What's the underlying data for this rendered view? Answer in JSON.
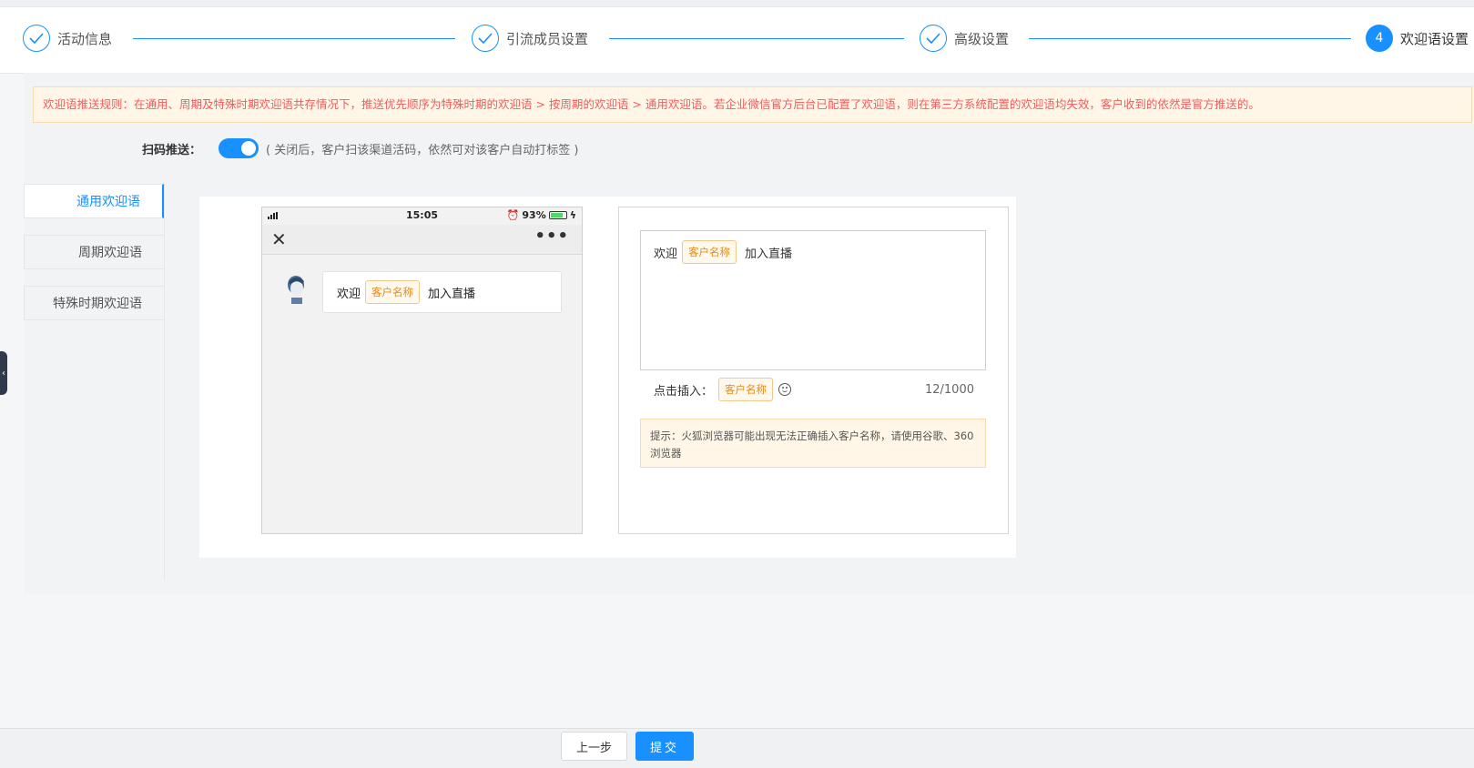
{
  "steps": [
    {
      "label": "活动信息",
      "state": "done"
    },
    {
      "label": "引流成员设置",
      "state": "done"
    },
    {
      "label": "高级设置",
      "state": "done"
    },
    {
      "label": "欢迎语设置",
      "state": "active",
      "number": "4"
    }
  ],
  "notice": "欢迎语推送规则：在通用、周期及特殊时期欢迎语共存情况下，推送优先顺序为特殊时期的欢迎语 > 按周期的欢迎语 > 通用欢迎语。若企业微信官方后台已配置了欢迎语，则在第三方系统配置的欢迎语均失效，客户收到的依然是官方推送的。",
  "scan_push": {
    "label": "扫码推送：",
    "enabled": true,
    "hint": "( 关闭后，客户扫该渠道活码，依然可对该客户自动打标签 )"
  },
  "tabs": [
    "通用欢迎语",
    "周期欢迎语",
    "特殊时期欢迎语"
  ],
  "active_tab": 0,
  "phone": {
    "time": "15:05",
    "battery": "93%",
    "message_prefix": "欢迎",
    "message_chip": "客户名称",
    "message_suffix": "加入直播"
  },
  "editor": {
    "text_prefix": "欢迎",
    "text_chip": "客户名称",
    "text_suffix": "加入直播",
    "insert_label": "点击插入：",
    "insert_chip": "客户名称",
    "counter": "12/1000",
    "tip": "提示：火狐浏览器可能出现无法正确插入客户名称，请使用谷歌、360浏览器"
  },
  "footer": {
    "prev_label": "上一步",
    "submit_label": "提交"
  },
  "colors": {
    "primary": "#1890ff",
    "warning_text": "#f25c5c",
    "chip_text": "#e88a1a"
  }
}
